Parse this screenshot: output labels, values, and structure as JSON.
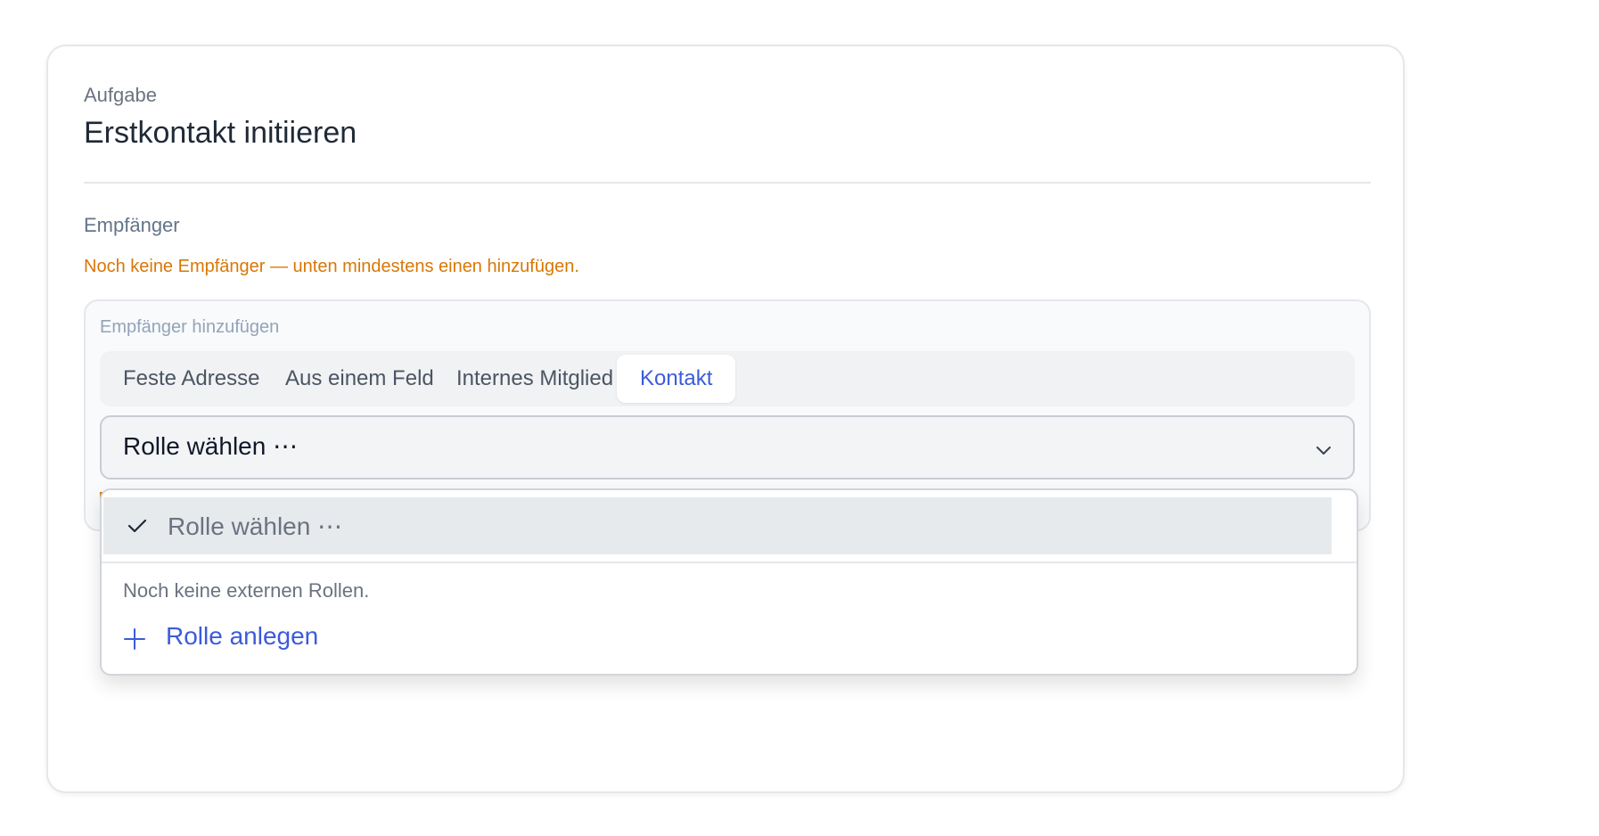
{
  "task": {
    "kicker": "Aufgabe",
    "title": "Erstkontakt initiieren"
  },
  "recipients": {
    "label": "Empfänger",
    "warning": "Noch keine Empfänger — unten mindestens einen hinzufügen.",
    "add_panel": {
      "title": "Empfänger hinzufügen",
      "tabs": [
        {
          "label": "Feste Adresse",
          "active": false
        },
        {
          "label": "Aus einem Feld",
          "active": false
        },
        {
          "label": "Internes Mitglied",
          "active": false
        },
        {
          "label": "Kontakt",
          "active": true
        }
      ],
      "select": {
        "value": "Rolle wählen ⋯",
        "icon": "chevron-down-icon"
      }
    }
  },
  "dropdown": {
    "selected_option": "Rolle wählen ⋯",
    "check_icon": "check-icon",
    "empty_note": "Noch keine externen Rollen.",
    "create_action": "Rolle anlegen",
    "create_icon": "plus-icon"
  },
  "colors": {
    "accent": "#3b5bdb",
    "warning": "#d97706",
    "text": "#1f2937",
    "muted": "#6b7280"
  }
}
